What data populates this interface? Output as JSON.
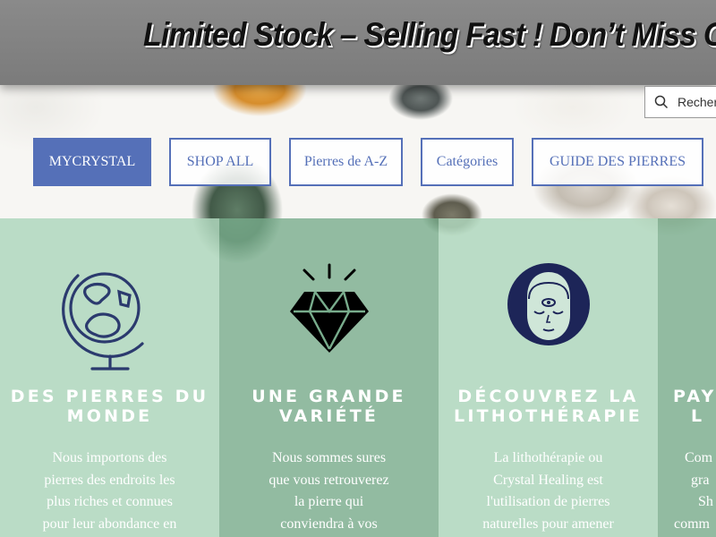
{
  "promo": {
    "text": "Limited Stock – Selling Fast ! Don’t Miss Out"
  },
  "search": {
    "placeholder": "Recher"
  },
  "nav": {
    "items": [
      {
        "label": "MYCRYSTAL",
        "active": true
      },
      {
        "label": "SHOP ALL"
      },
      {
        "label": "Pierres de A-Z"
      },
      {
        "label": "Catégories"
      },
      {
        "label": "GUIDE DES PIERRES"
      }
    ]
  },
  "colors": {
    "nav_accent": "#5570b8",
    "icon_navy": "#1f2a5c",
    "column_light": "#b0d7be",
    "column_dark": "#78ac8c"
  },
  "features": [
    {
      "icon": "globe-icon",
      "title_lines": [
        "DES PIERRES DU",
        "MONDE"
      ],
      "text_lines": [
        "Nous importons des",
        "pierres des endroits les",
        "plus riches et connues",
        "pour leur abondance en"
      ]
    },
    {
      "icon": "diamond-icon",
      "title_lines": [
        "UNE GRANDE",
        "VARIÉTÉ"
      ],
      "text_lines": [
        "Nous sommes sures",
        "que vous retrouverez",
        "la pierre qui",
        "conviendra à vos"
      ]
    },
    {
      "icon": "third-eye-face-icon",
      "title_lines": [
        "DÉCOUVREZ LA",
        "LITHOTHÉRAPIE"
      ],
      "text_lines": [
        "La lithothérapie ou",
        "Crystal Healing est",
        "l'utilisation de pierres",
        "naturelles pour amener"
      ]
    },
    {
      "icon": "",
      "title_lines": [
        "PAY",
        "L"
      ],
      "text_lines": [
        "Com",
        "gra",
        "Sh",
        "comm"
      ]
    }
  ]
}
